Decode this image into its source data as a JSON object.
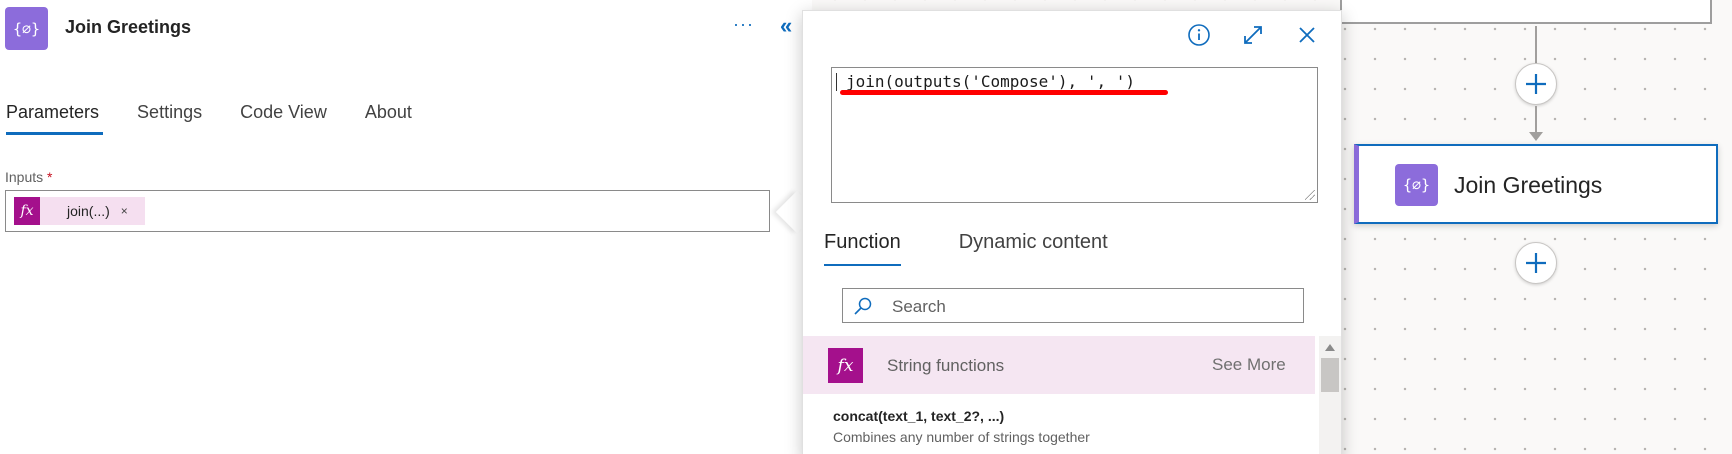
{
  "panel": {
    "title": "Join Greetings",
    "action_icon": "{∅}",
    "more_label": "···",
    "collapse_label": "«",
    "tabs": [
      {
        "label": "Parameters",
        "active": true
      },
      {
        "label": "Settings",
        "active": false
      },
      {
        "label": "Code View",
        "active": false
      },
      {
        "label": "About",
        "active": false
      }
    ],
    "inputs_label": "Inputs",
    "required_mark": "*",
    "token": {
      "icon": "fx",
      "label": "join(...)",
      "close": "×"
    }
  },
  "expression_editor": {
    "expression": "join(outputs('Compose'), ', ')",
    "icons": [
      "info-icon",
      "expand-icon",
      "close-icon"
    ],
    "tabs": [
      {
        "label": "Function",
        "active": true
      },
      {
        "label": "Dynamic content",
        "active": false
      }
    ],
    "search_placeholder": "Search",
    "category": {
      "icon": "fx",
      "label": "String functions",
      "see_more": "See More"
    },
    "functions": [
      {
        "signature": "concat(text_1, text_2?, ...)",
        "description": "Combines any number of strings together"
      }
    ]
  },
  "canvas": {
    "node_title": "Join Greetings",
    "node_icon": "{∅}"
  },
  "colors": {
    "accent": "#0f6cbd",
    "action_purple": "#8c6cdb",
    "function_magenta": "#a4108c",
    "highlight_red": "#ff0000"
  }
}
